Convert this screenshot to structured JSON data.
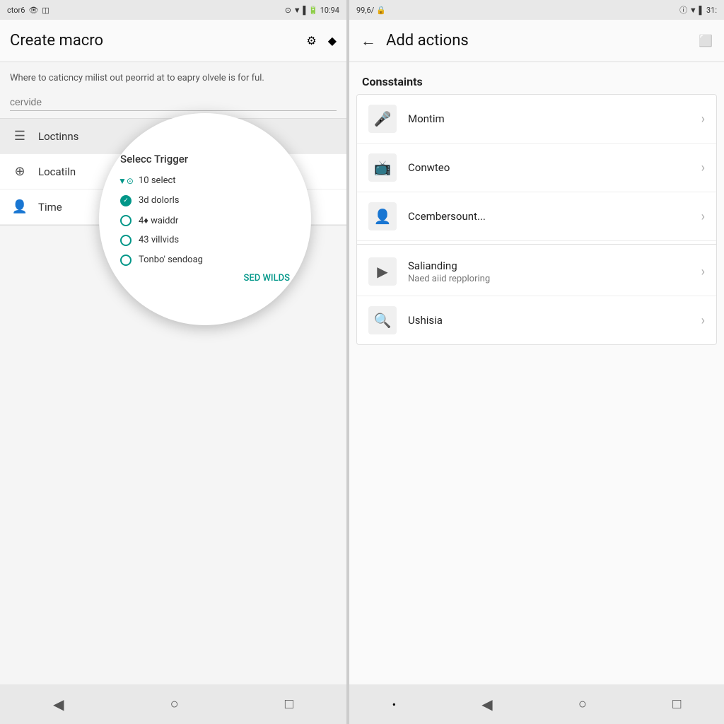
{
  "left": {
    "status_bar": {
      "app_name": "ctor6",
      "time": "10:94"
    },
    "app_bar": {
      "title": "Create macro",
      "icon1": "⚙",
      "icon2": "◆"
    },
    "description": "Where to caticncy milist out peorrid at to eapry olvele is for ful.",
    "service_placeholder": "cervide",
    "trigger_items": [
      {
        "icon": "☰",
        "label": "Loctinns",
        "active": true
      },
      {
        "icon": "⊕",
        "label": "Locatiln",
        "active": false
      },
      {
        "icon": "👤",
        "label": "Time",
        "active": false
      }
    ],
    "dropdown": {
      "title": "Selecc Trigger",
      "items": [
        {
          "label": "10 select",
          "type": "down-arrow"
        },
        {
          "label": "3d dolorls",
          "type": "filled"
        },
        {
          "label": "4♦ waiddr",
          "type": "empty"
        },
        {
          "label": "43 villvids",
          "type": "empty"
        },
        {
          "label": "Tonbo' sendoag",
          "type": "empty"
        }
      ],
      "action_label": "SED WILDS"
    },
    "nav": {
      "back": "◀",
      "home": "○",
      "recents": "□"
    }
  },
  "right": {
    "status_bar": {
      "battery": "99,6/",
      "time": "31:"
    },
    "app_bar": {
      "back_arrow": "←",
      "title": "Add actions",
      "icon": "⬜"
    },
    "section_header": "Consstaints",
    "action_items": [
      {
        "icon": "🎤",
        "title": "Montim",
        "subtitle": "",
        "has_divider": false
      },
      {
        "icon": "📺",
        "title": "Conwteo",
        "subtitle": "",
        "has_divider": false
      },
      {
        "icon": "👤",
        "title": "Ccembersount...",
        "subtitle": "",
        "has_divider": true
      },
      {
        "icon": "▶",
        "title": "Salianding",
        "subtitle": "Naed aiid repploring",
        "has_divider": false
      },
      {
        "icon": "🔍",
        "title": "Ushisia",
        "subtitle": "",
        "has_divider": false
      }
    ],
    "nav": {
      "dot": "•",
      "back": "◀",
      "home": "○",
      "recents": "□"
    }
  }
}
